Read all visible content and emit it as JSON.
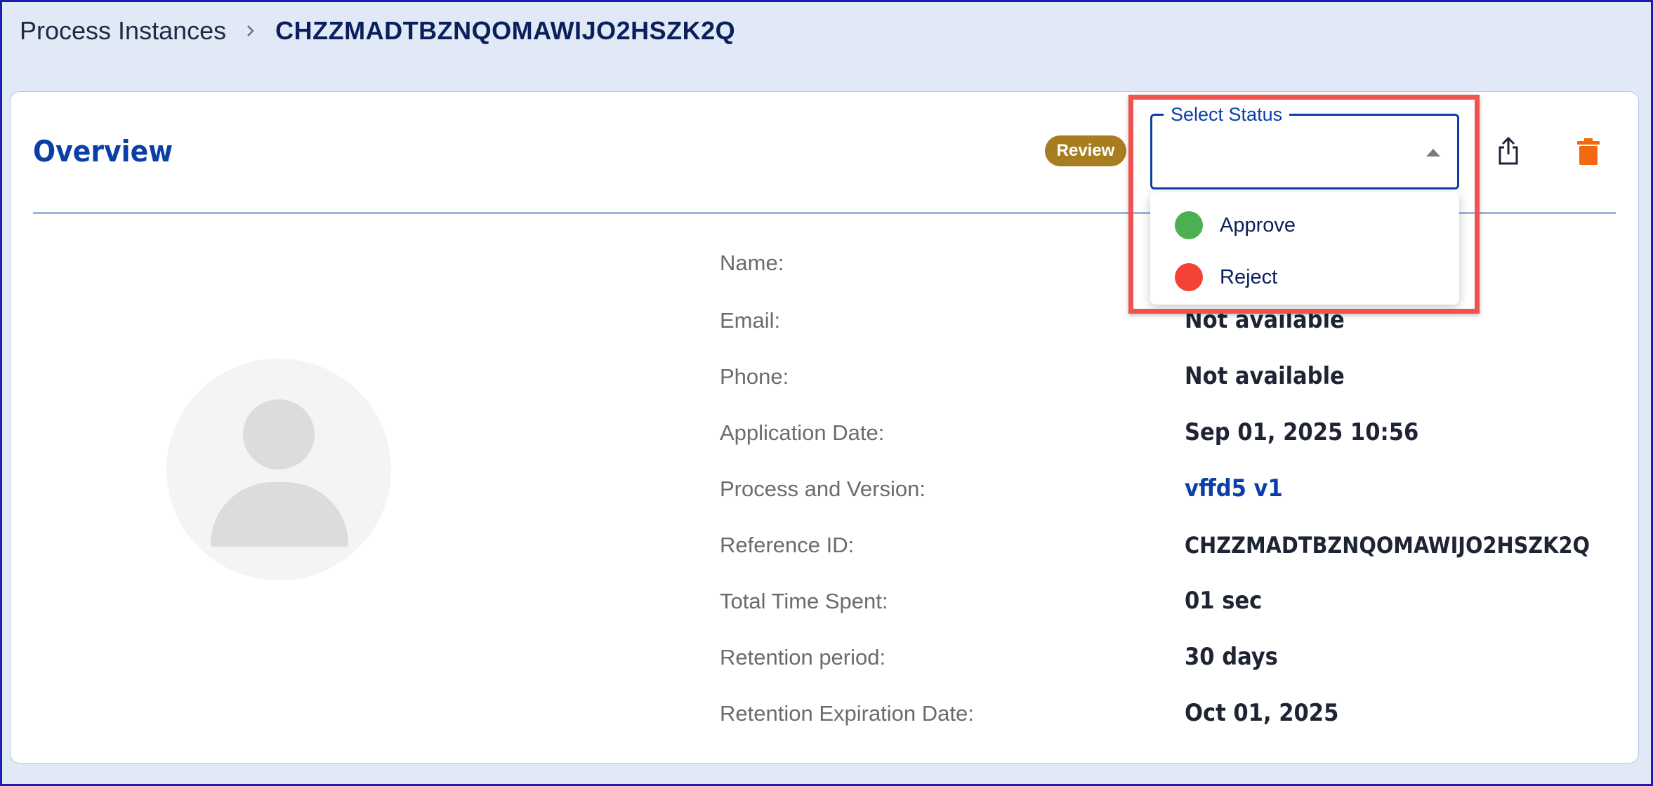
{
  "breadcrumb": {
    "parent": "Process Instances",
    "current": "CHZZMADTBZNQOMAWIJO2HSZK2Q"
  },
  "overview": {
    "title": "Overview",
    "status_badge": "Review",
    "status_select": {
      "label": "Select Status",
      "value": "",
      "options": [
        {
          "label": "Approve",
          "color": "#4caf50"
        },
        {
          "label": "Reject",
          "color": "#f44336"
        }
      ]
    },
    "share_icon": "share-icon",
    "delete_icon": "trash-icon"
  },
  "details": {
    "name_label": "Name:",
    "email_label": "Email:",
    "email_value": "Not available",
    "phone_label": "Phone:",
    "phone_value": "Not available",
    "app_date_label": "Application Date:",
    "app_date_value": "Sep 01, 2025 10:56",
    "process_label": "Process and Version:",
    "process_value": "vffd5 v1",
    "ref_label": "Reference ID:",
    "ref_value": "CHZZMADTBZNQOMAWIJO2HSZK2Q",
    "time_label": "Total Time Spent:",
    "time_value": "01 sec",
    "retention_label": "Retention period:",
    "retention_value": "30 days",
    "expiration_label": "Retention Expiration Date:",
    "expiration_value": "Oct 01, 2025"
  },
  "colors": {
    "accent": "#0b3fa8",
    "badge": "#a87d1f",
    "delete": "#f26a10",
    "highlight": "#f0524e"
  }
}
